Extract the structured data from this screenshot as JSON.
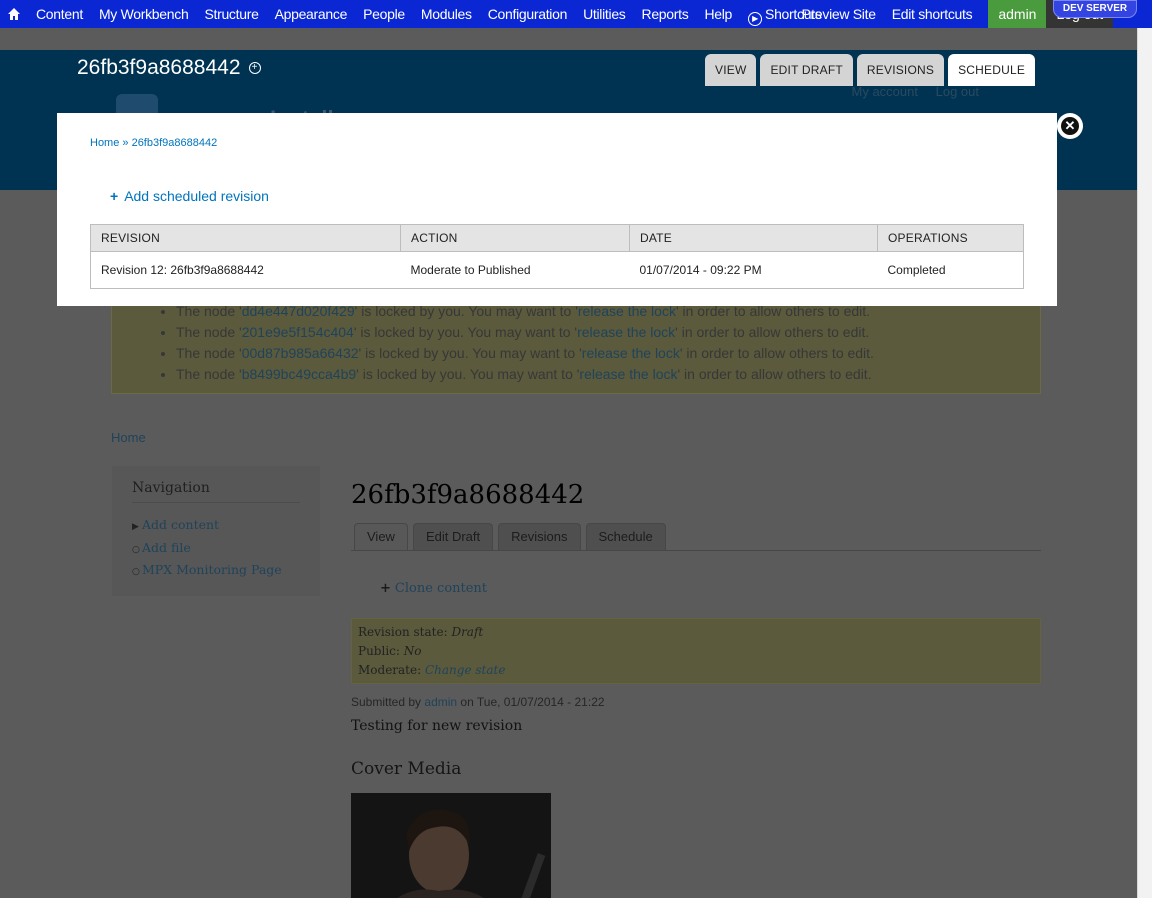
{
  "toolbar": {
    "items": [
      "Content",
      "My Workbench",
      "Structure",
      "Appearance",
      "People",
      "Modules",
      "Configuration",
      "Utilities",
      "Reports",
      "Help"
    ],
    "shortcuts_label": "Shortcuts",
    "preview_label": "Preview Site",
    "edit_shortcuts": "Edit shortcuts",
    "admin": "admin",
    "logout": "Log out",
    "dev_badge": "DEV SERVER"
  },
  "header": {
    "node_title": "26fb3f9a8688442",
    "site_name": "Install",
    "my_account": "My account",
    "log_out": "Log out",
    "tabs": [
      "VIEW",
      "EDIT DRAFT",
      "REVISIONS",
      "SCHEDULE"
    ]
  },
  "modal": {
    "breadcrumb": "Home » 26fb3f9a8688442",
    "add_scheduled": "Add scheduled revision",
    "columns": [
      "REVISION",
      "ACTION",
      "DATE",
      "OPERATIONS"
    ],
    "rows": [
      [
        "Revision 12: 26fb3f9a8688442",
        "Moderate to Published",
        "01/07/2014 - 09:22 PM",
        "Completed"
      ]
    ]
  },
  "messages": [
    {
      "pre": "The node '",
      "node": "dd4e447d020f429",
      "mid": "' is locked by you. You may want to '",
      "link": "release the lock",
      "post": "' in order to allow others to edit."
    },
    {
      "pre": "The node '",
      "node": "201e9e5f154c404",
      "mid": "' is locked by you. You may want to '",
      "link": "release the lock",
      "post": "' in order to allow others to edit."
    },
    {
      "pre": "The node '",
      "node": "00d87b985a66432",
      "mid": "' is locked by you. You may want to '",
      "link": "release the lock",
      "post": "' in order to allow others to edit."
    },
    {
      "pre": "The node '",
      "node": "b8499bc49cca4b9",
      "mid": "' is locked by you. You may want to '",
      "link": "release the lock",
      "post": "' in order to allow others to edit."
    }
  ],
  "page": {
    "breadcrumb": "Home",
    "navigation": {
      "title": "Navigation",
      "items": [
        "Add content",
        "Add file",
        "MPX Monitoring Page"
      ]
    },
    "title": "26fb3f9a8688442",
    "tabs": [
      "View",
      "Edit Draft",
      "Revisions",
      "Schedule"
    ],
    "clone": "Clone content",
    "revision_state_label": "Revision state:",
    "revision_state": "Draft",
    "public_label": "Public:",
    "public": "No",
    "moderate_label": "Moderate:",
    "moderate_link": "Change state",
    "submitted_pre": "Submitted by",
    "submitted_user": "admin",
    "submitted_post": "on Tue, 01/07/2014 - 21:22",
    "body": "Testing for new revision",
    "cover_heading": "Cover Media"
  }
}
